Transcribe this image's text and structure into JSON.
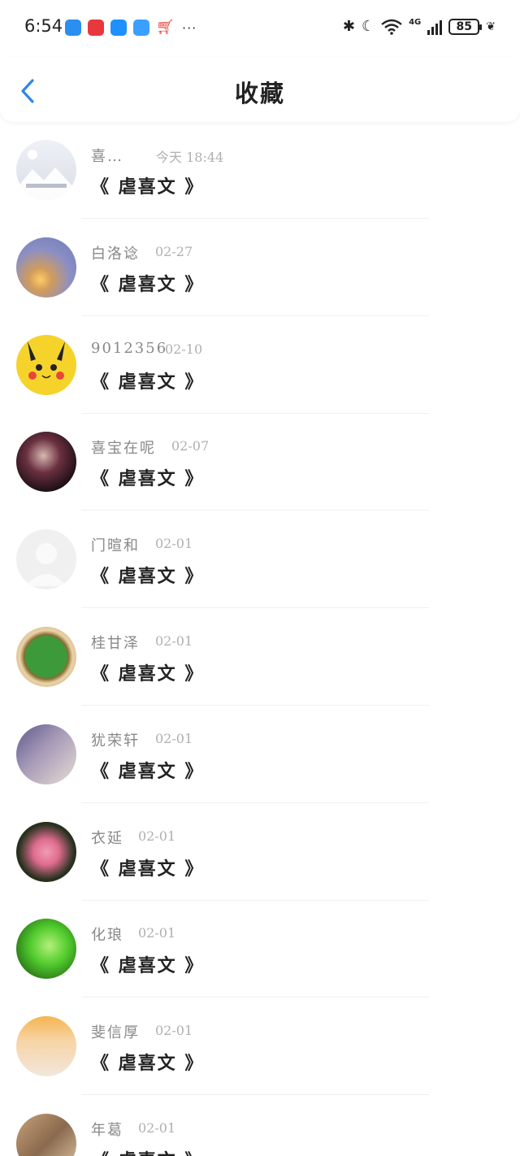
{
  "status_bar": {
    "time": "6:54",
    "more": "···",
    "network": "4G",
    "battery": "85"
  },
  "header": {
    "title": "收藏"
  },
  "items": [
    {
      "name": "喜…",
      "date": "今天 18:44",
      "content": "《 虐喜文 》",
      "avatar": "placeholder-image"
    },
    {
      "name": "白洛谂",
      "date": "02-27",
      "content": "《 虐喜文 》",
      "avatar": "sunset-photo"
    },
    {
      "name": "9012356",
      "date": "02-10",
      "content": "《 虐喜文 》",
      "avatar": "pikachu"
    },
    {
      "name": "喜宝在呢",
      "date": "02-07",
      "content": "《 虐喜文 》",
      "avatar": "anime-character"
    },
    {
      "name": "门暄和",
      "date": "02-01",
      "content": "《 虐喜文 》",
      "avatar": "default-user"
    },
    {
      "name": "桂甘泽",
      "date": "02-01",
      "content": "《 虐喜文 》",
      "avatar": "badge-emblem"
    },
    {
      "name": "犹荣轩",
      "date": "02-01",
      "content": "《 虐喜文 》",
      "avatar": "couple-photo"
    },
    {
      "name": "衣延",
      "date": "02-01",
      "content": "《 虐喜文 》",
      "avatar": "pink-roses"
    },
    {
      "name": "化琅",
      "date": "02-01",
      "content": "《 虐喜文 》",
      "avatar": "green-portrait"
    },
    {
      "name": "斐信厚",
      "date": "02-01",
      "content": "《 虐喜文 》",
      "avatar": "cartoon-doll"
    },
    {
      "name": "年葛",
      "date": "02-01",
      "content": "《 虐喜文 》",
      "avatar": "portrait-photo"
    }
  ]
}
